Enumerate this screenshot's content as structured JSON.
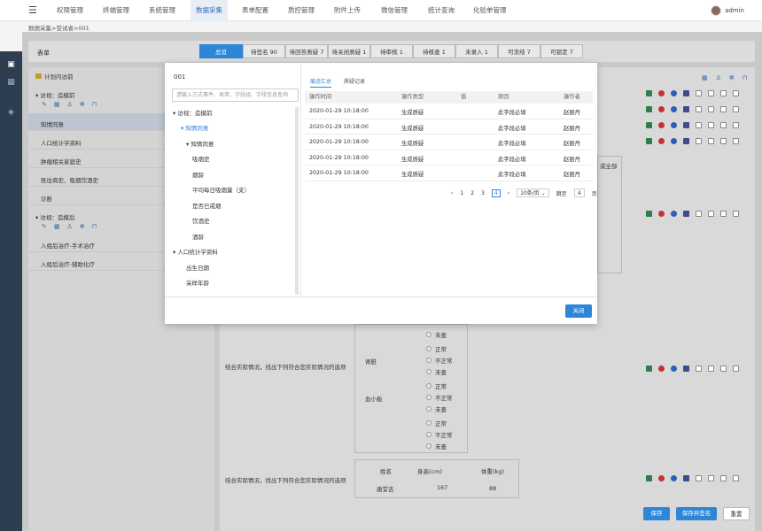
{
  "topbar": {
    "menu_icon": "hamburger-icon",
    "nav": [
      {
        "label": "权限管理"
      },
      {
        "label": "终端管理"
      },
      {
        "label": "系统管理"
      },
      {
        "label": "数据采集"
      },
      {
        "label": "表单配置"
      },
      {
        "label": "质控管理"
      },
      {
        "label": "附件上传"
      },
      {
        "label": "微信管理"
      },
      {
        "label": "统计查询"
      },
      {
        "label": "化验单管理"
      }
    ],
    "active_index": 3,
    "user": "admin"
  },
  "breadcrumb": "数据采集>受试者>001",
  "sidebar": {
    "icons": [
      "clipboard-icon",
      "gift-icon",
      "cube-icon"
    ]
  },
  "form": {
    "label": "表单",
    "tabs": [
      {
        "label": "总览"
      },
      {
        "label": "待签名 90"
      },
      {
        "label": "待回答质疑 7"
      },
      {
        "label": "待关闭质疑 1"
      },
      {
        "label": "待审核 1"
      },
      {
        "label": "待核查 1"
      },
      {
        "label": "未录入 1"
      },
      {
        "label": "可冻结 7"
      },
      {
        "label": "可锁定 7"
      }
    ]
  },
  "left_panel": {
    "title": "计划内访前",
    "visit1": "访视：造模前",
    "items1": [
      "知情同意",
      "人口统计学资料",
      "肿瘤相关家庭史",
      "既往病史、吸烟饮酒史",
      "诊断"
    ],
    "visit2": "访视：造模后",
    "items2": [
      "入组后治疗-手术治疗",
      "入组后治疗-辅助化疗"
    ]
  },
  "main": {
    "question": "结合实际情况，找出下列符合您实际情况的选项",
    "partial_header": "或全部",
    "organs": [
      "肾脏",
      "血小板"
    ],
    "options": [
      "正常",
      "不正常",
      "未查"
    ],
    "pending": "未查",
    "measure_headers": [
      "姓名",
      "身高(cm)",
      "体重(kg)"
    ],
    "measure_row": [
      "唐堂吉",
      "167",
      "88"
    ]
  },
  "footer_buttons": {
    "save": "保存",
    "save_sign": "保存并签名",
    "reset": "重置"
  },
  "modal": {
    "title": "001",
    "search_placeholder": "请输入方式事件、表单、字段组、字段信息查询",
    "tree": [
      {
        "label": "访视：造模前",
        "level": 0,
        "arrow": true
      },
      {
        "label": "知情同意",
        "level": 1,
        "arrow": true,
        "highlight": true
      },
      {
        "label": "知情同意",
        "level": 2,
        "arrow": true
      },
      {
        "label": "吸烟史",
        "level": 3
      },
      {
        "label": "烟龄",
        "level": 3
      },
      {
        "label": "平均每日吸烟量（支）",
        "level": 3
      },
      {
        "label": "是否已戒烟",
        "level": 3
      },
      {
        "label": "饮酒史",
        "level": 3
      },
      {
        "label": "酒龄",
        "level": 3
      },
      {
        "label": "人口统计学资料",
        "level": 1,
        "arrow": true
      },
      {
        "label": "出生日期",
        "level": 2
      },
      {
        "label": "采样年龄",
        "level": 2
      }
    ],
    "tabs": [
      "痕迹汇总",
      "质疑记录"
    ],
    "table_headers": [
      "操作时间",
      "操作类型",
      "值",
      "原因",
      "操作者"
    ],
    "rows": [
      [
        "2020-01-29 10:18:00",
        "生成质疑",
        "",
        "此字段必填",
        "赵丽丹"
      ],
      [
        "2020-01-29 10:18:00",
        "生成质疑",
        "",
        "此字段必填",
        "赵丽丹"
      ],
      [
        "2020-01-29 10:18:00",
        "生成质疑",
        "",
        "此字段必填",
        "赵丽丹"
      ],
      [
        "2020-01-29 10:18:00",
        "生成质疑",
        "",
        "此字段必填",
        "赵丽丹"
      ],
      [
        "2020-01-29 10:18:00",
        "生成质疑",
        "",
        "此字段必填",
        "赵丽丹"
      ]
    ],
    "pager": {
      "prev": "‹",
      "pages": [
        "1",
        "2",
        "3",
        "4"
      ],
      "current": "4",
      "next": "›",
      "size": "10条/页",
      "goto": "跳至",
      "goto_value": "4",
      "page_unit": "页"
    },
    "close_label": "关闭"
  }
}
